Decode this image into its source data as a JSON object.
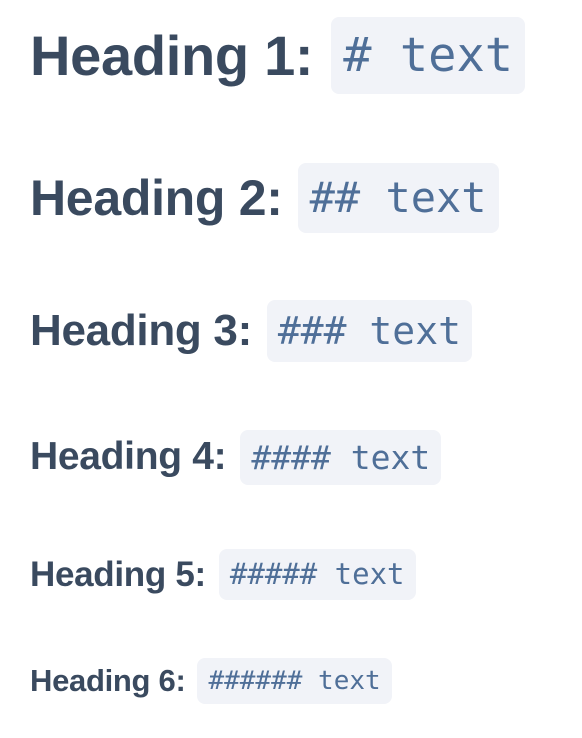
{
  "headings": [
    {
      "label": "Heading 1:",
      "syntax": "# text"
    },
    {
      "label": "Heading 2:",
      "syntax": "## text"
    },
    {
      "label": "Heading 3:",
      "syntax": "### text"
    },
    {
      "label": "Heading 4:",
      "syntax": "#### text"
    },
    {
      "label": "Heading 5:",
      "syntax": "##### text"
    },
    {
      "label": "Heading 6:",
      "syntax": "###### text"
    }
  ],
  "colors": {
    "label_text": "#3a4a5f",
    "code_text": "#4f6f98",
    "code_background": "#f1f3f8",
    "page_background": "#ffffff"
  }
}
